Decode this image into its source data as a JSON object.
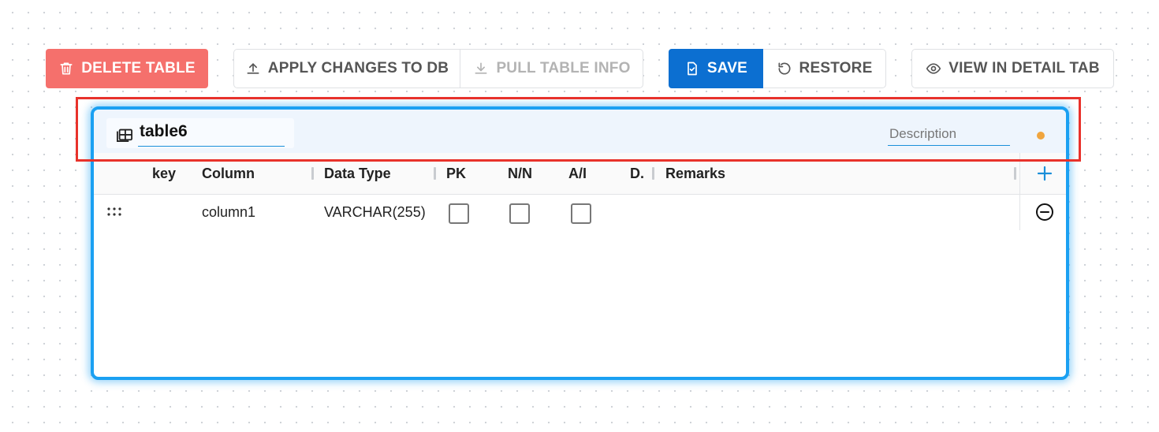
{
  "toolbar": {
    "delete_label": "DELETE TABLE",
    "apply_label": "APPLY CHANGES TO DB",
    "pull_label": "PULL TABLE INFO",
    "save_label": "SAVE",
    "restore_label": "RESTORE",
    "view_label": "VIEW IN DETAIL TAB"
  },
  "table": {
    "name": "table6",
    "description_placeholder": "Description",
    "description_value": ""
  },
  "columns": {
    "key": "key",
    "column": "Column",
    "data_type": "Data Type",
    "pk": "PK",
    "nn": "N/N",
    "ai": "A/I",
    "default": "D.",
    "remarks": "Remarks"
  },
  "rows": [
    {
      "name": "column1",
      "data_type": "VARCHAR(255)",
      "pk": false,
      "nn": false,
      "ai": false,
      "remarks": ""
    }
  ],
  "icons": {
    "delete": "trash-icon",
    "apply": "upload-icon",
    "pull": "download-icon",
    "save": "save-document-icon",
    "restore": "restore-icon",
    "view": "eye-icon",
    "table": "table-icon",
    "add": "plus-icon",
    "remove": "minus-circle-icon",
    "drag": "drag-handle-icon"
  },
  "colors": {
    "delete": "#f5706c",
    "save": "#0c6fd1",
    "card_border": "#1aa0f2",
    "highlight": "#e8322b",
    "status_dot": "#f0a53e",
    "accent": "#1a8fd9"
  }
}
